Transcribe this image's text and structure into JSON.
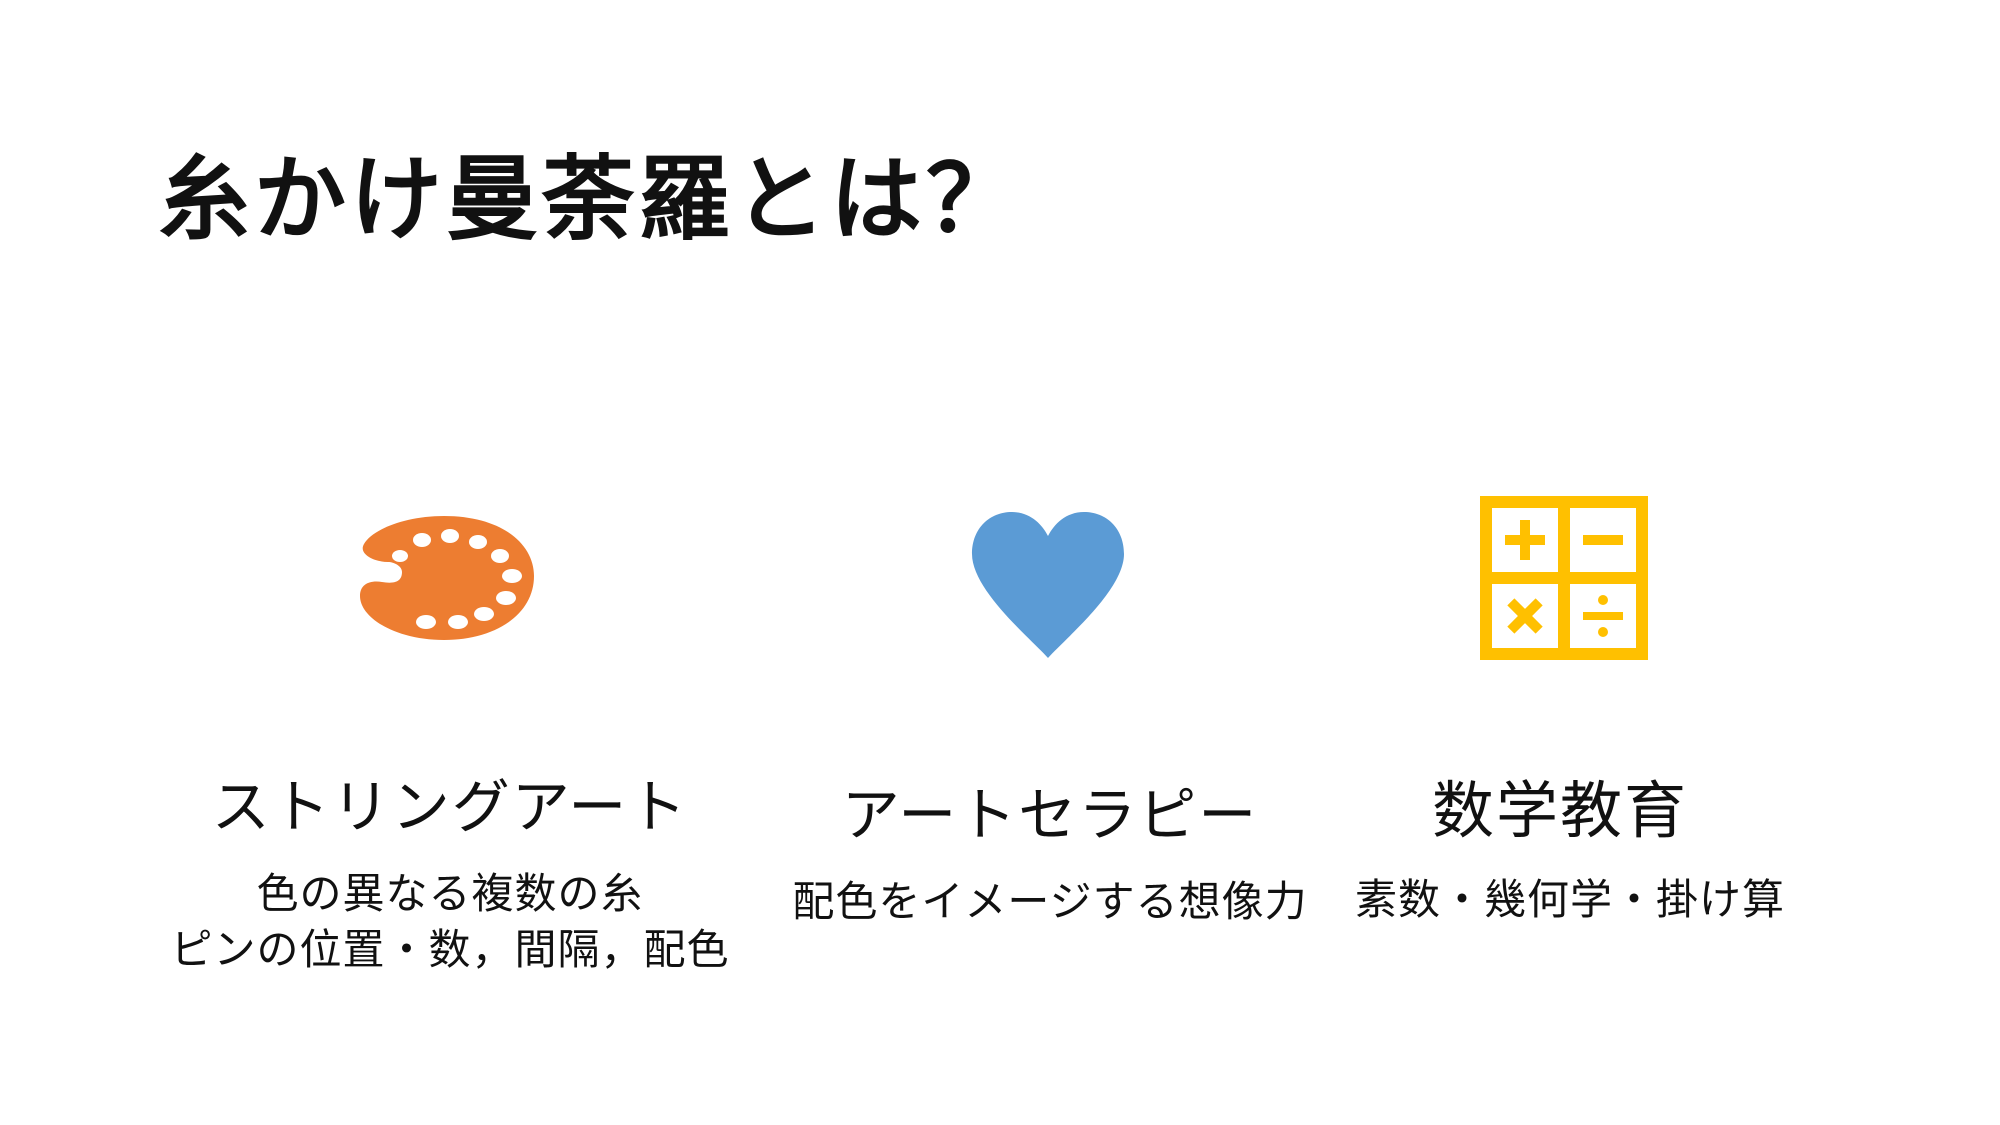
{
  "title": "糸かけ曼荼羅とは？",
  "colors": {
    "palette": "#ED7D31",
    "heart": "#5B9BD5",
    "calculator": "#FFC000"
  },
  "columns": [
    {
      "icon": "palette-icon",
      "heading": "ストリングアート",
      "desc_lines": [
        "色の異なる複数の糸",
        "ピンの位置・数，間隔，配色"
      ]
    },
    {
      "icon": "heart-icon",
      "heading": "アートセラピー",
      "desc_lines": [
        "配色をイメージする想像力"
      ]
    },
    {
      "icon": "calculator-icon",
      "heading": "数学教育",
      "desc_lines": [
        "素数・幾何学・掛け算"
      ]
    }
  ]
}
